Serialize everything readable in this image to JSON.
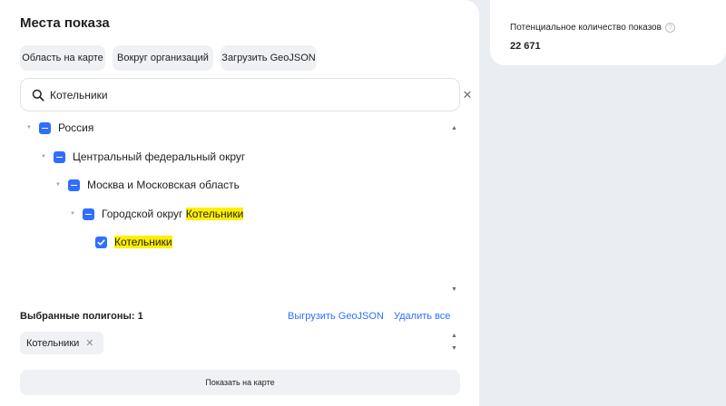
{
  "panel": {
    "title": "Места показа",
    "buttons": {
      "map_area": "Область на карте",
      "around_orgs": "Вокруг организаций",
      "upload_geojson": "Загрузить GeoJSON"
    },
    "search": {
      "value": "Котельники",
      "placeholder": ""
    },
    "tree": [
      {
        "label": "Россия",
        "state": "partial",
        "highlight": ""
      },
      {
        "label": "Центральный федеральный округ",
        "state": "partial",
        "highlight": ""
      },
      {
        "label": "Москва и Московская область",
        "state": "partial",
        "highlight": ""
      },
      {
        "label": "Городской округ ",
        "state": "partial",
        "highlight": "Котельники"
      },
      {
        "label": "",
        "state": "checked",
        "highlight": "Котельники"
      }
    ],
    "selected": {
      "label": "Выбранные полигоны: 1",
      "export_link": "Выгрузить GeoJSON",
      "delete_link": "Удалить все",
      "tags": [
        "Котельники"
      ]
    },
    "show_on_map": "Показать на карте"
  },
  "side": {
    "label": "Потенциальное количество показов",
    "help_icon": "?",
    "value": "22 671"
  },
  "colors": {
    "accent": "#2f6eff",
    "highlight": "#ffef00",
    "chip_bg": "#f0f1f4",
    "page_bg": "#eaedf1"
  }
}
